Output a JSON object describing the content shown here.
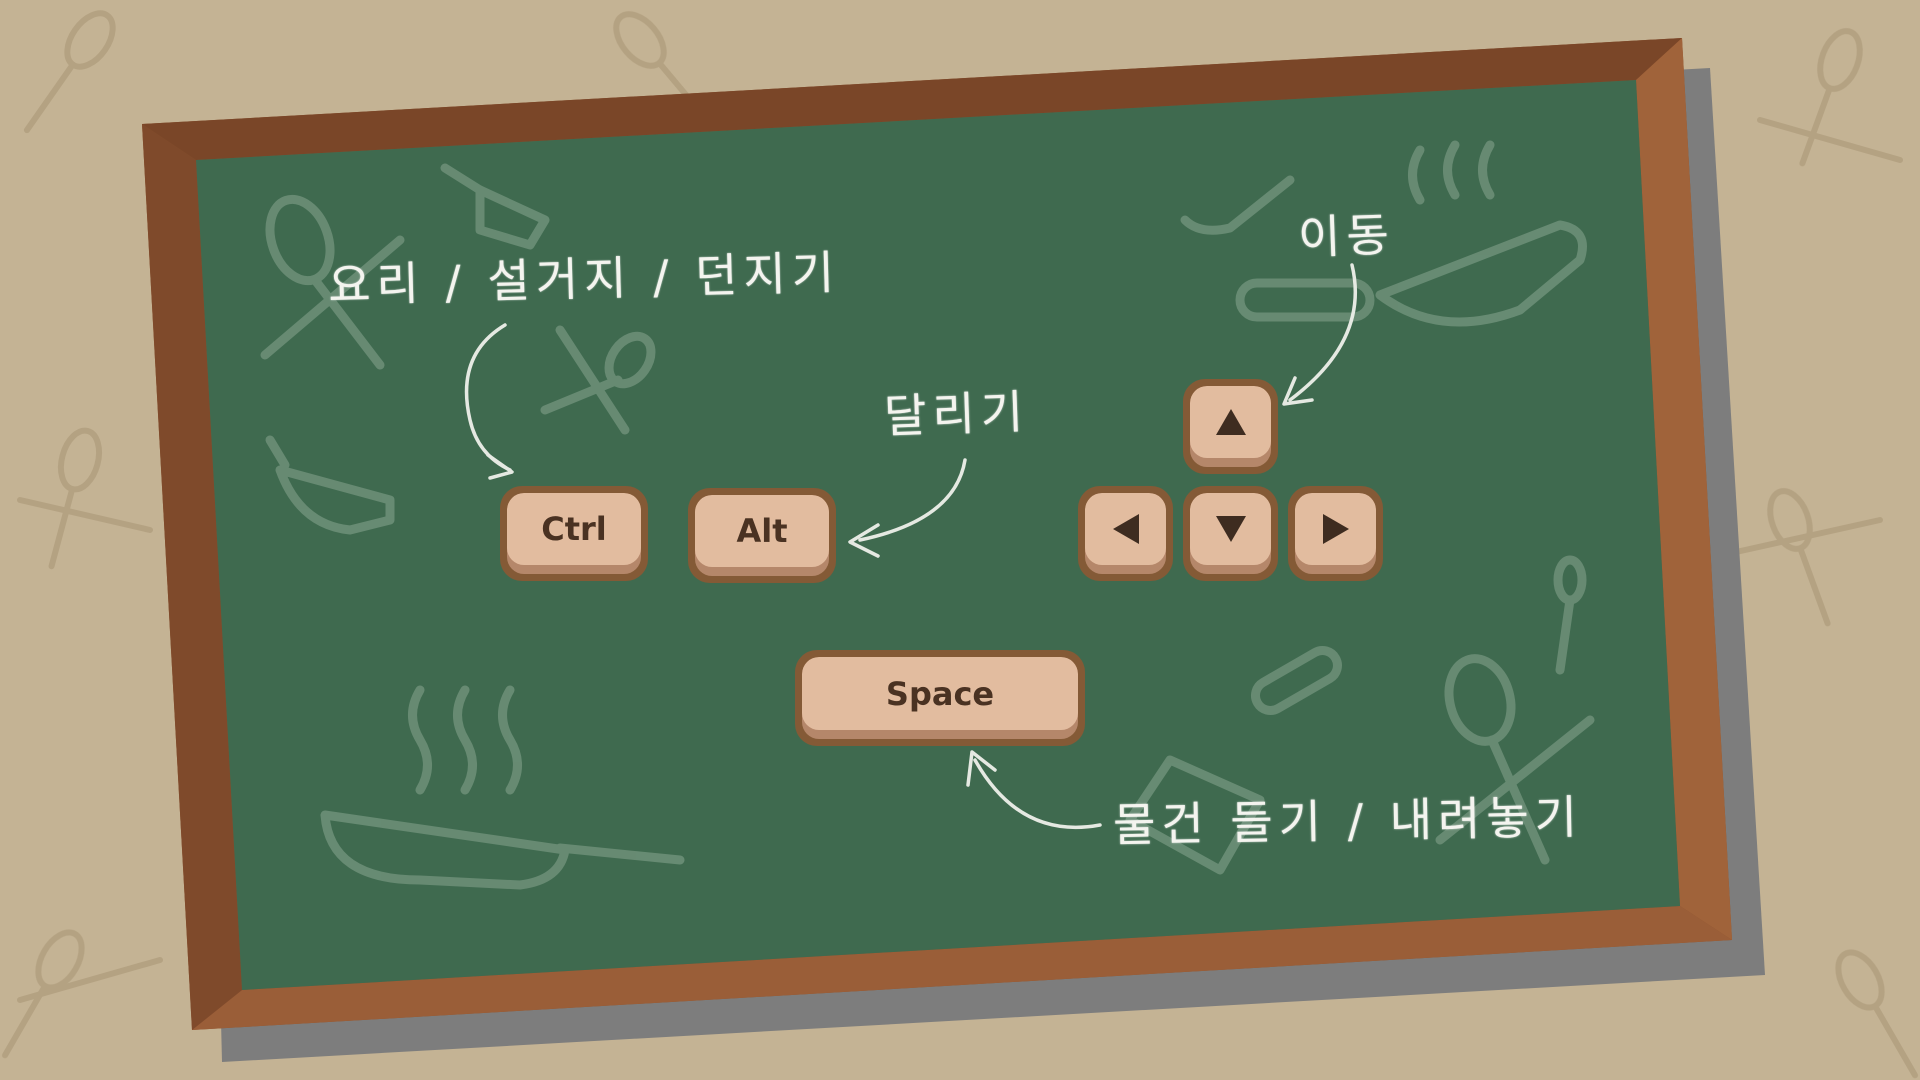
{
  "labels": {
    "action": "요리 / 설거지 / 던지기",
    "run": "달리기",
    "move": "이동",
    "pickup": "물건 들기 / 내려놓기"
  },
  "keys": {
    "ctrl": "Ctrl",
    "alt": "Alt",
    "space": "Space"
  },
  "arrow_icons": [
    "arrow-up-icon",
    "arrow-left-icon",
    "arrow-down-icon",
    "arrow-right-icon"
  ],
  "colors": {
    "background": "#c4b394",
    "frame": "#8c5330",
    "board": "#3f6a4f",
    "key_face": "#e2bc9f",
    "key_border": "#845a36",
    "chalk": "#f4f4ef"
  }
}
